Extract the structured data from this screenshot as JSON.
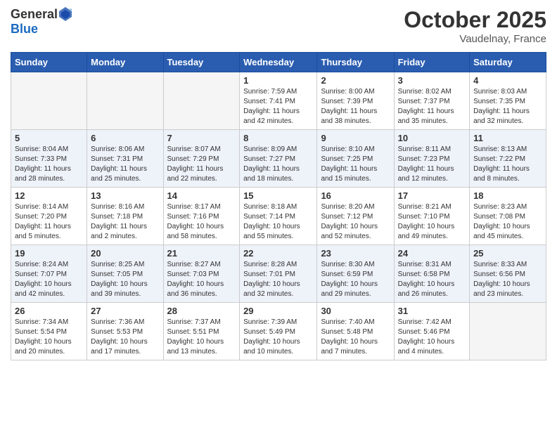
{
  "header": {
    "logo_line1": "General",
    "logo_line2": "Blue",
    "month": "October 2025",
    "location": "Vaudelnay, France"
  },
  "weekdays": [
    "Sunday",
    "Monday",
    "Tuesday",
    "Wednesday",
    "Thursday",
    "Friday",
    "Saturday"
  ],
  "weeks": [
    [
      {
        "day": "",
        "info": ""
      },
      {
        "day": "",
        "info": ""
      },
      {
        "day": "",
        "info": ""
      },
      {
        "day": "1",
        "info": "Sunrise: 7:59 AM\nSunset: 7:41 PM\nDaylight: 11 hours\nand 42 minutes."
      },
      {
        "day": "2",
        "info": "Sunrise: 8:00 AM\nSunset: 7:39 PM\nDaylight: 11 hours\nand 38 minutes."
      },
      {
        "day": "3",
        "info": "Sunrise: 8:02 AM\nSunset: 7:37 PM\nDaylight: 11 hours\nand 35 minutes."
      },
      {
        "day": "4",
        "info": "Sunrise: 8:03 AM\nSunset: 7:35 PM\nDaylight: 11 hours\nand 32 minutes."
      }
    ],
    [
      {
        "day": "5",
        "info": "Sunrise: 8:04 AM\nSunset: 7:33 PM\nDaylight: 11 hours\nand 28 minutes."
      },
      {
        "day": "6",
        "info": "Sunrise: 8:06 AM\nSunset: 7:31 PM\nDaylight: 11 hours\nand 25 minutes."
      },
      {
        "day": "7",
        "info": "Sunrise: 8:07 AM\nSunset: 7:29 PM\nDaylight: 11 hours\nand 22 minutes."
      },
      {
        "day": "8",
        "info": "Sunrise: 8:09 AM\nSunset: 7:27 PM\nDaylight: 11 hours\nand 18 minutes."
      },
      {
        "day": "9",
        "info": "Sunrise: 8:10 AM\nSunset: 7:25 PM\nDaylight: 11 hours\nand 15 minutes."
      },
      {
        "day": "10",
        "info": "Sunrise: 8:11 AM\nSunset: 7:23 PM\nDaylight: 11 hours\nand 12 minutes."
      },
      {
        "day": "11",
        "info": "Sunrise: 8:13 AM\nSunset: 7:22 PM\nDaylight: 11 hours\nand 8 minutes."
      }
    ],
    [
      {
        "day": "12",
        "info": "Sunrise: 8:14 AM\nSunset: 7:20 PM\nDaylight: 11 hours\nand 5 minutes."
      },
      {
        "day": "13",
        "info": "Sunrise: 8:16 AM\nSunset: 7:18 PM\nDaylight: 11 hours\nand 2 minutes."
      },
      {
        "day": "14",
        "info": "Sunrise: 8:17 AM\nSunset: 7:16 PM\nDaylight: 10 hours\nand 58 minutes."
      },
      {
        "day": "15",
        "info": "Sunrise: 8:18 AM\nSunset: 7:14 PM\nDaylight: 10 hours\nand 55 minutes."
      },
      {
        "day": "16",
        "info": "Sunrise: 8:20 AM\nSunset: 7:12 PM\nDaylight: 10 hours\nand 52 minutes."
      },
      {
        "day": "17",
        "info": "Sunrise: 8:21 AM\nSunset: 7:10 PM\nDaylight: 10 hours\nand 49 minutes."
      },
      {
        "day": "18",
        "info": "Sunrise: 8:23 AM\nSunset: 7:08 PM\nDaylight: 10 hours\nand 45 minutes."
      }
    ],
    [
      {
        "day": "19",
        "info": "Sunrise: 8:24 AM\nSunset: 7:07 PM\nDaylight: 10 hours\nand 42 minutes."
      },
      {
        "day": "20",
        "info": "Sunrise: 8:25 AM\nSunset: 7:05 PM\nDaylight: 10 hours\nand 39 minutes."
      },
      {
        "day": "21",
        "info": "Sunrise: 8:27 AM\nSunset: 7:03 PM\nDaylight: 10 hours\nand 36 minutes."
      },
      {
        "day": "22",
        "info": "Sunrise: 8:28 AM\nSunset: 7:01 PM\nDaylight: 10 hours\nand 32 minutes."
      },
      {
        "day": "23",
        "info": "Sunrise: 8:30 AM\nSunset: 6:59 PM\nDaylight: 10 hours\nand 29 minutes."
      },
      {
        "day": "24",
        "info": "Sunrise: 8:31 AM\nSunset: 6:58 PM\nDaylight: 10 hours\nand 26 minutes."
      },
      {
        "day": "25",
        "info": "Sunrise: 8:33 AM\nSunset: 6:56 PM\nDaylight: 10 hours\nand 23 minutes."
      }
    ],
    [
      {
        "day": "26",
        "info": "Sunrise: 7:34 AM\nSunset: 5:54 PM\nDaylight: 10 hours\nand 20 minutes."
      },
      {
        "day": "27",
        "info": "Sunrise: 7:36 AM\nSunset: 5:53 PM\nDaylight: 10 hours\nand 17 minutes."
      },
      {
        "day": "28",
        "info": "Sunrise: 7:37 AM\nSunset: 5:51 PM\nDaylight: 10 hours\nand 13 minutes."
      },
      {
        "day": "29",
        "info": "Sunrise: 7:39 AM\nSunset: 5:49 PM\nDaylight: 10 hours\nand 10 minutes."
      },
      {
        "day": "30",
        "info": "Sunrise: 7:40 AM\nSunset: 5:48 PM\nDaylight: 10 hours\nand 7 minutes."
      },
      {
        "day": "31",
        "info": "Sunrise: 7:42 AM\nSunset: 5:46 PM\nDaylight: 10 hours\nand 4 minutes."
      },
      {
        "day": "",
        "info": ""
      }
    ]
  ]
}
